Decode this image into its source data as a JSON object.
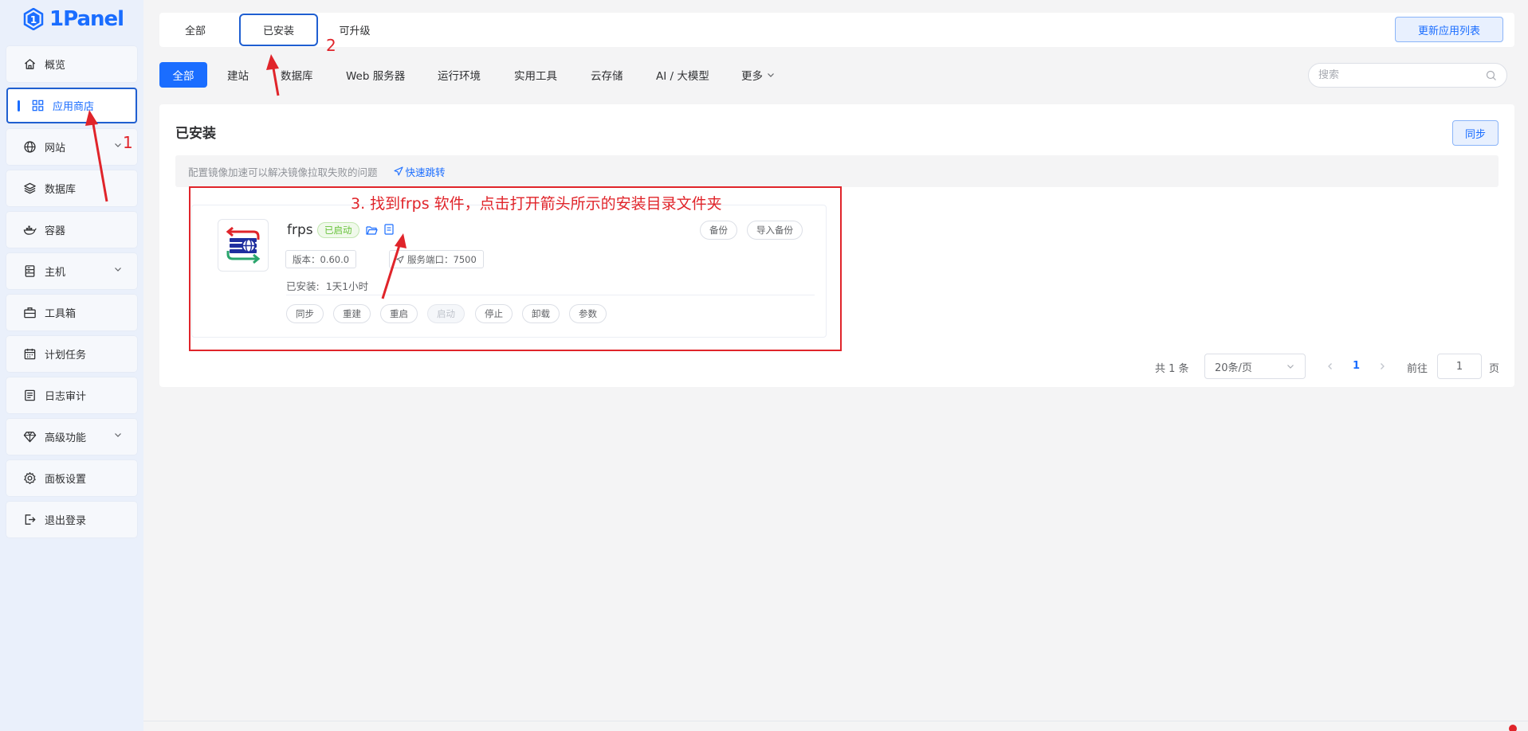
{
  "brand": {
    "name": "1Panel"
  },
  "sidebar": {
    "items": [
      {
        "label": "概览",
        "icon": "home-icon"
      },
      {
        "label": "应用商店",
        "icon": "apps-grid-icon",
        "active": true
      },
      {
        "label": "网站",
        "icon": "globe-icon",
        "expandable": true
      },
      {
        "label": "数据库",
        "icon": "layers-icon"
      },
      {
        "label": "容器",
        "icon": "docker-icon"
      },
      {
        "label": "主机",
        "icon": "server-icon",
        "expandable": true
      },
      {
        "label": "工具箱",
        "icon": "toolbox-icon"
      },
      {
        "label": "计划任务",
        "icon": "calendar-icon"
      },
      {
        "label": "日志审计",
        "icon": "log-icon"
      },
      {
        "label": "高级功能",
        "icon": "diamond-icon",
        "expandable": true
      },
      {
        "label": "面板设置",
        "icon": "gear-icon"
      },
      {
        "label": "退出登录",
        "icon": "logout-icon"
      }
    ]
  },
  "top_tabs": {
    "items": [
      {
        "label": "全部"
      },
      {
        "label": "已安装",
        "active": true
      },
      {
        "label": "可升级"
      }
    ],
    "refresh_label": "更新应用列表"
  },
  "categories": {
    "items": [
      {
        "label": "全部",
        "active": true
      },
      {
        "label": "建站"
      },
      {
        "label": "数据库"
      },
      {
        "label": "Web 服务器"
      },
      {
        "label": "运行环境"
      },
      {
        "label": "实用工具"
      },
      {
        "label": "云存储"
      },
      {
        "label": "AI / 大模型"
      },
      {
        "label": "更多"
      }
    ],
    "search_placeholder": "搜索"
  },
  "panel": {
    "title": "已安装",
    "sync_label": "同步",
    "notice": "配置镜像加速可以解决镜像拉取失败的问题",
    "notice_link": "快速跳转"
  },
  "app": {
    "name": "frps",
    "status": "已启动",
    "version_label": "版本：0.60.0",
    "port_label": "服务端口：7500",
    "installed_label": "已安装:",
    "installed_value": "1天1小时",
    "side_buttons": [
      "备份",
      "导入备份"
    ],
    "actions": [
      {
        "label": "同步"
      },
      {
        "label": "重建"
      },
      {
        "label": "重启"
      },
      {
        "label": "启动",
        "disabled": true
      },
      {
        "label": "停止"
      },
      {
        "label": "卸载"
      },
      {
        "label": "参数"
      }
    ]
  },
  "pagination": {
    "total": "共 1 条",
    "page_size": "20条/页",
    "current_page": "1",
    "goto_prefix": "前往",
    "goto_value": "1",
    "goto_suffix": "页"
  },
  "annotations": {
    "step1": "1",
    "step2": "2",
    "step3": "3. 找到frps 软件，点击打开箭头所示的安装目录文件夹"
  },
  "colors": {
    "primary": "#1a6dff",
    "annotation": "#e0242a",
    "success": "#67c23a"
  }
}
